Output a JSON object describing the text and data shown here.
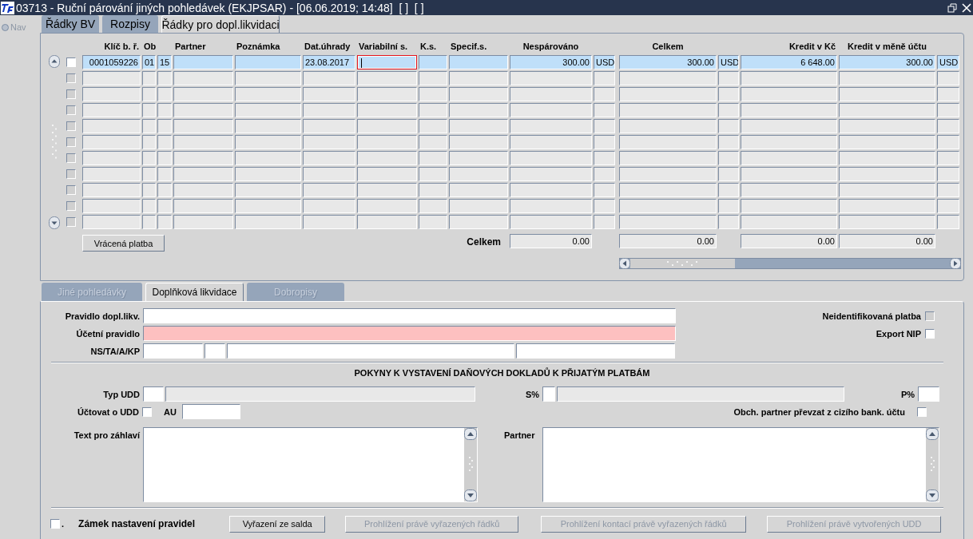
{
  "window": {
    "title": "03713 - Ruční párování jiných pohledávek (EKJPSAR) - [06.06.2019; 14:48]  [ ]  [ ]"
  },
  "nav": {
    "label": "Nav",
    "disabled": true
  },
  "tabs": [
    {
      "label": "Řádky BV",
      "selected": false
    },
    {
      "label": "Rozpisy",
      "selected": false
    },
    {
      "label": "Řádky pro dopl.likvidaci",
      "selected": true
    }
  ],
  "table": {
    "column_headers": [
      "Klíč b. ř.",
      "Ob",
      "Partner",
      "Poznámka",
      "Dat.úhrady",
      "Variabilní s.",
      "K.s.",
      "Specif.s.",
      "Nespárováno",
      "Celkem",
      "Kredit v Kč",
      "Kredit v měně účtu"
    ],
    "rows": [
      {
        "selected": true,
        "checked": false,
        "cells": [
          {
            "focused": false,
            "text": "0001059226"
          },
          {
            "focused": false,
            "text": "01"
          },
          {
            "focused": false,
            "text": "15"
          },
          {
            "focused": false
          },
          {
            "focused": false
          },
          {
            "focused": false,
            "text": "23.08.2017"
          },
          {
            "focused": true
          },
          {
            "focused": false
          },
          {
            "focused": false
          },
          {
            "focused": false,
            "text": "300.00"
          },
          {
            "focused": false,
            "text": "USD"
          },
          {
            "focused": false,
            "text": "300.00"
          },
          {
            "focused": false,
            "text": "USD"
          },
          {
            "focused": false,
            "text": "6 648.00"
          },
          {
            "focused": false,
            "text": "300.00"
          },
          {
            "focused": false,
            "text": "USD"
          }
        ]
      },
      {
        "selected": false,
        "checked": false
      },
      {
        "selected": false,
        "checked": false
      },
      {
        "selected": false,
        "checked": false
      },
      {
        "selected": false,
        "checked": false
      },
      {
        "selected": false,
        "checked": false
      },
      {
        "selected": false,
        "checked": false
      },
      {
        "selected": false,
        "checked": false
      },
      {
        "selected": false,
        "checked": false
      },
      {
        "selected": false,
        "checked": false
      },
      {
        "selected": false,
        "checked": false
      }
    ],
    "totals": {
      "label": "Celkem",
      "nesparovano": "0.00",
      "celkem": "0.00",
      "kredit_v_kc": "0.00",
      "kredit_v_mene_uctu": "0.00"
    }
  },
  "returned_payment_button": "Vrácená platba",
  "detail_tabs": [
    {
      "label": "Jiné pohledávky",
      "selected": false,
      "disabled": true
    },
    {
      "label": "Doplňková likvidace",
      "selected": true,
      "disabled": false
    },
    {
      "label": "Dobropisy",
      "selected": false,
      "disabled": true
    }
  ],
  "form": {
    "pravidlo": {
      "label": "Pravidlo dopl.likv."
    },
    "ucetni_pravidlo": {
      "label": "Účetní pravidlo",
      "required": true
    },
    "ns_ta_a_kp": {
      "label": "NS/TA/A/KP"
    },
    "neidentifikovana_platba": {
      "label": "Neidentifikovaná platba",
      "checked": false,
      "disabled": true
    },
    "export_nip": {
      "label": "Export NIP",
      "checked": false,
      "disabled": false
    },
    "section_heading": "POKYNY K VYSTAVENÍ DAŇOVÝCH DOKLADŮ K PŘIJATÝM PLATBÁM",
    "typ_udd": {
      "label": "Typ UDD"
    },
    "s_pct": {
      "label": "S%"
    },
    "p_pct": {
      "label": "P%"
    },
    "uctovat_o_udd": {
      "label": "Účtovat o UDD",
      "checked": false
    },
    "au": {
      "label": "AU"
    },
    "obch_partner": {
      "label": "Obch. partner převzat z cizího bank. účtu",
      "checked": false
    },
    "text_pro_zahlavi": {
      "label": "Text pro záhlaví"
    },
    "partner": {
      "label": "Partner"
    }
  },
  "footer": {
    "lock": {
      "mark": ".",
      "checked": false
    },
    "lock_label": "Zámek nastavení pravidel",
    "buttons": [
      {
        "label": "Vyřazení ze salda",
        "disabled": false
      },
      {
        "label": "Prohlížení právě vyřazených řádků",
        "disabled": true
      },
      {
        "label": "Prohlížení kontací právě vyřazených řádků",
        "disabled": true
      },
      {
        "label": "Prohlížení právě vytvořených UDD",
        "disabled": true
      }
    ]
  }
}
